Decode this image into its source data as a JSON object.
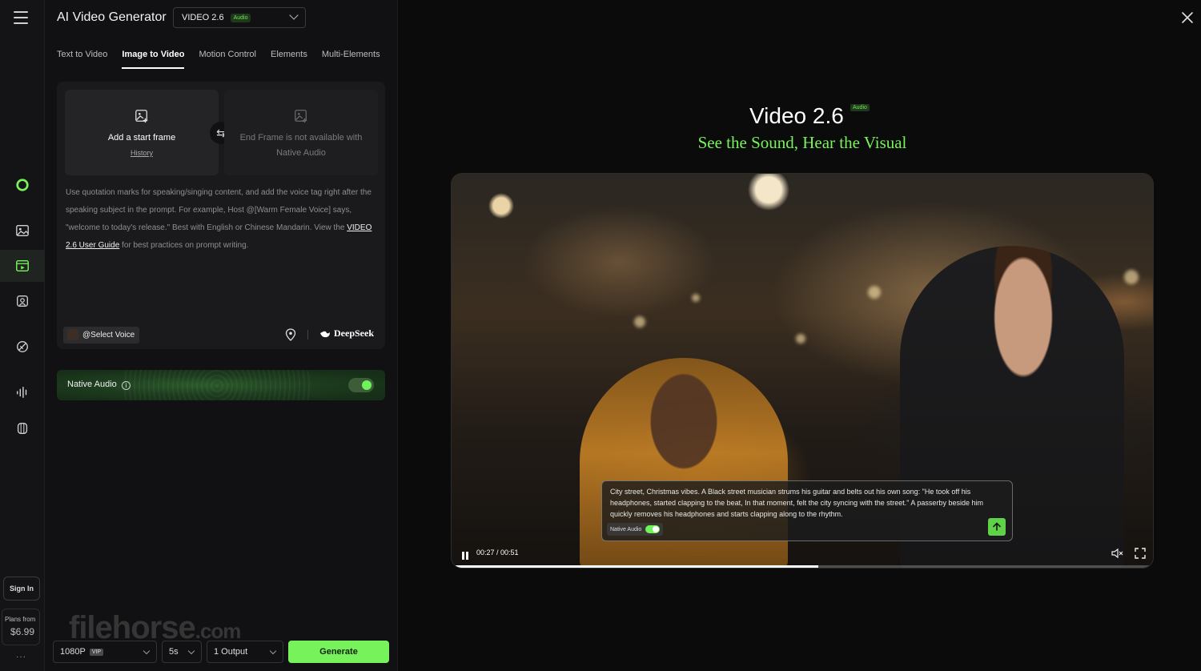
{
  "app": {
    "title": "AI Video Generator",
    "model": {
      "label": "VIDEO 2.6",
      "badge": "Audio"
    }
  },
  "tabs": [
    {
      "label": "Text to Video",
      "active": false
    },
    {
      "label": "Image to Video",
      "active": true
    },
    {
      "label": "Motion Control",
      "active": false
    },
    {
      "label": "Elements",
      "active": false
    },
    {
      "label": "Multi-Elements",
      "active": false
    }
  ],
  "rail": {
    "icons": [
      "menu-icon",
      "logo-icon",
      "image-icon",
      "video-icon",
      "avatar-icon",
      "effects-icon",
      "audio-icon",
      "assets-icon"
    ],
    "sign_in": "Sign In",
    "plans_label": "Plans from",
    "plans_price": "$6.99",
    "more": "···"
  },
  "frames": {
    "start_label": "Add a start frame",
    "history": "History",
    "end_label": "End Frame is not available with Native Audio"
  },
  "hint": {
    "text": "Use quotation marks for speaking/singing content, and add the voice tag right after the speaking subject in the prompt. For example, Host @[Warm Female Voice] says, \"welcome to today's release.\" Best with English or Chinese Mandarin. View the ",
    "link": "VIDEO 2.6 User Guide",
    "suffix": " for best practices on prompt writing."
  },
  "editor_footer": {
    "select_voice": "@Select Voice",
    "deepseek": "DeepSeek"
  },
  "native_audio": {
    "label": "Native Audio",
    "enabled": true
  },
  "bottom": {
    "resolution": "1080P",
    "vip": "VIP",
    "duration": "5s",
    "outputs": "1 Output",
    "generate": "Generate"
  },
  "watermark": {
    "main": "filehorse",
    "suffix": ".com"
  },
  "hero": {
    "title": "Video 2.6",
    "badge": "Audio",
    "subtitle": "See the Sound, Hear the Visual"
  },
  "player": {
    "prompt": "City street, Christmas vibes. A Black street musician strums his guitar and belts out his own song: \"He took off his headphones, started clapping to the beat, In that moment, felt the city syncing with the street.\" A passerby beside him quickly removes his headphones and starts clapping along to the rhythm.",
    "native_audio": "Native Audio",
    "timecode": "00:27 / 00:51",
    "progress": 0.523
  },
  "colors": {
    "accent": "#77f25a",
    "background": "#0b0b0c",
    "panel": "#111113"
  }
}
